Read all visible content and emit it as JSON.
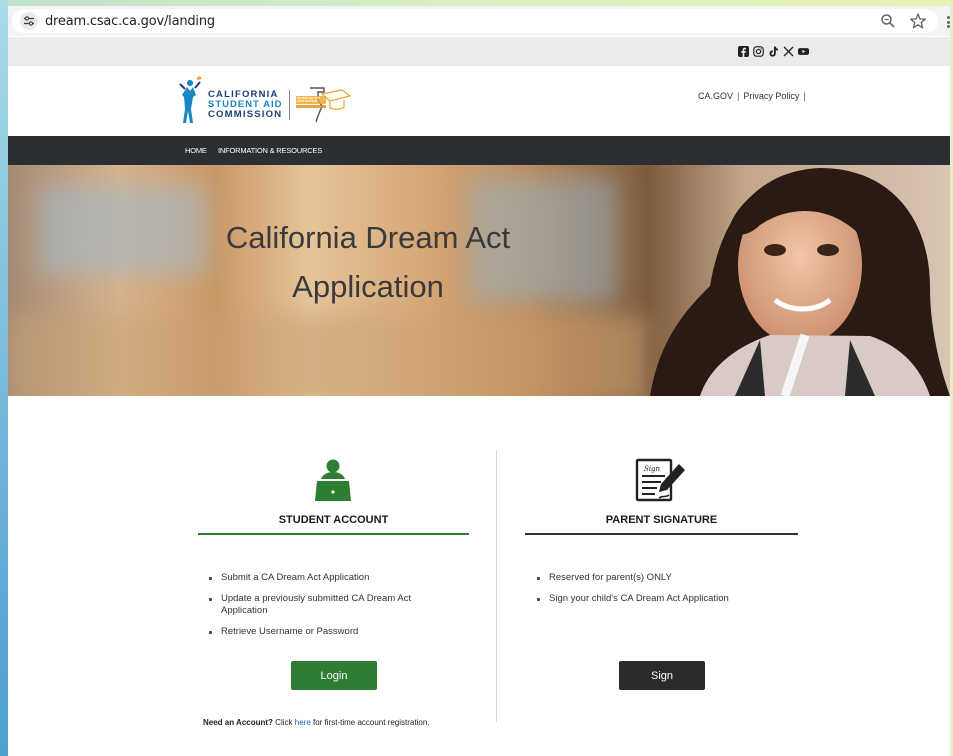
{
  "browser": {
    "url": "dream.csac.ca.gov/landing",
    "icons": [
      "site-info-icon",
      "zoom-icon",
      "bookmark-star-icon",
      "browser-menu-icon"
    ]
  },
  "social": {
    "icons": [
      "facebook-icon",
      "instagram-icon",
      "tiktok-icon",
      "x-icon",
      "youtube-icon"
    ]
  },
  "header": {
    "logo_line1": "CALIFORNIA",
    "logo_line2": "STUDENT AID",
    "logo_line3": "COMMISSION",
    "logo_badge": "CA DREAM ACT APPLICATION",
    "links": [
      "CA.GOV",
      "Privacy Policy"
    ],
    "separator": "|"
  },
  "nav": {
    "items": [
      "HOME",
      "INFORMATION & RESOURCES"
    ]
  },
  "hero": {
    "title_line1": "California Dream Act",
    "title_line2": "Application"
  },
  "student": {
    "title": "STUDENT ACCOUNT",
    "icon": "student-laptop-icon",
    "bullets": [
      "Submit a CA Dream Act Application",
      "Update a previously submitted CA Dream Act Application",
      "Retrieve Username or Password"
    ],
    "button": "Login"
  },
  "parent": {
    "title": "PARENT SIGNATURE",
    "icon": "signature-document-icon",
    "bullets": [
      "Reserved for parent(s) ONLY",
      "Sign your child's CA Dream Act Application"
    ],
    "button": "Sign"
  },
  "register": {
    "prefix": "Need an Account?",
    "text1": "Click",
    "link": "here",
    "text2": "for first-time account registration."
  },
  "colors": {
    "green": "#2e7d32",
    "dark": "#2b2f33",
    "link": "#1a5fb4"
  }
}
